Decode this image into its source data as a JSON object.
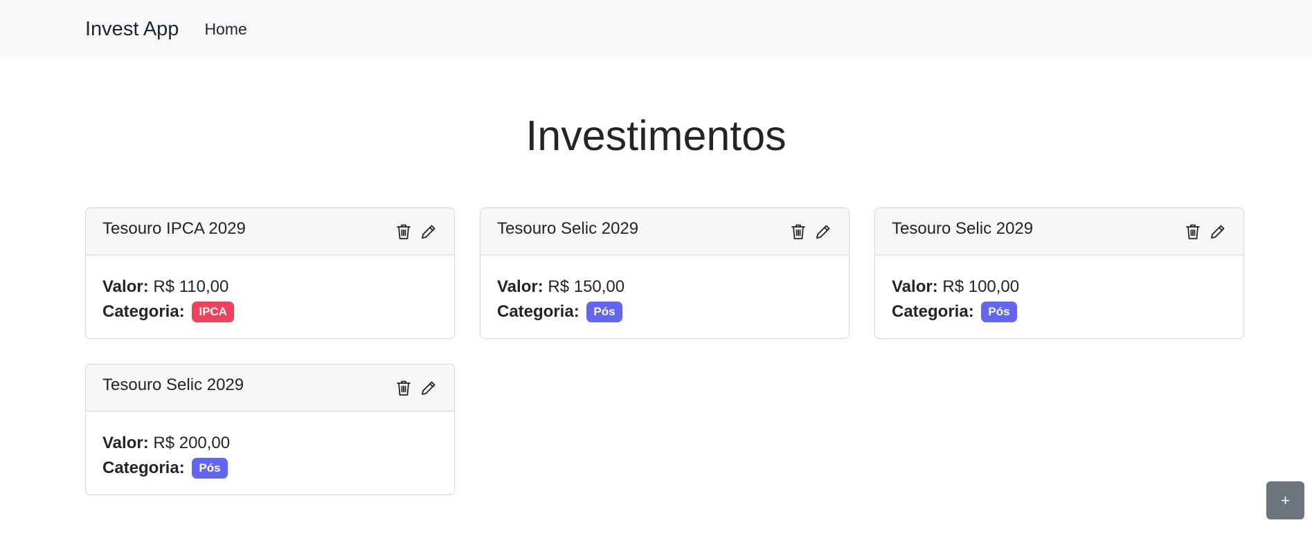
{
  "navbar": {
    "brand": "Invest App",
    "links": [
      {
        "label": "Home"
      }
    ]
  },
  "page": {
    "title": "Investimentos"
  },
  "labels": {
    "valor": "Valor:",
    "categoria": "Categoria:"
  },
  "investments": [
    {
      "title": "Tesouro IPCA 2029",
      "value": "R$ 110,00",
      "category": "IPCA",
      "badge_color": "#f0405b"
    },
    {
      "title": "Tesouro Selic 2029",
      "value": "R$ 150,00",
      "category": "Pós",
      "badge_color": "#6366f1"
    },
    {
      "title": "Tesouro Selic 2029",
      "value": "R$ 100,00",
      "category": "Pós",
      "badge_color": "#6366f1"
    },
    {
      "title": "Tesouro Selic 2029",
      "value": "R$ 200,00",
      "category": "Pós",
      "badge_color": "#6366f1"
    }
  ],
  "icons": {
    "delete": "trash-icon",
    "edit": "pencil-icon"
  },
  "fab": {
    "label": "+"
  },
  "colors": {
    "navbar_bg": "#f8f9fa",
    "fab_bg": "#6c757d"
  }
}
